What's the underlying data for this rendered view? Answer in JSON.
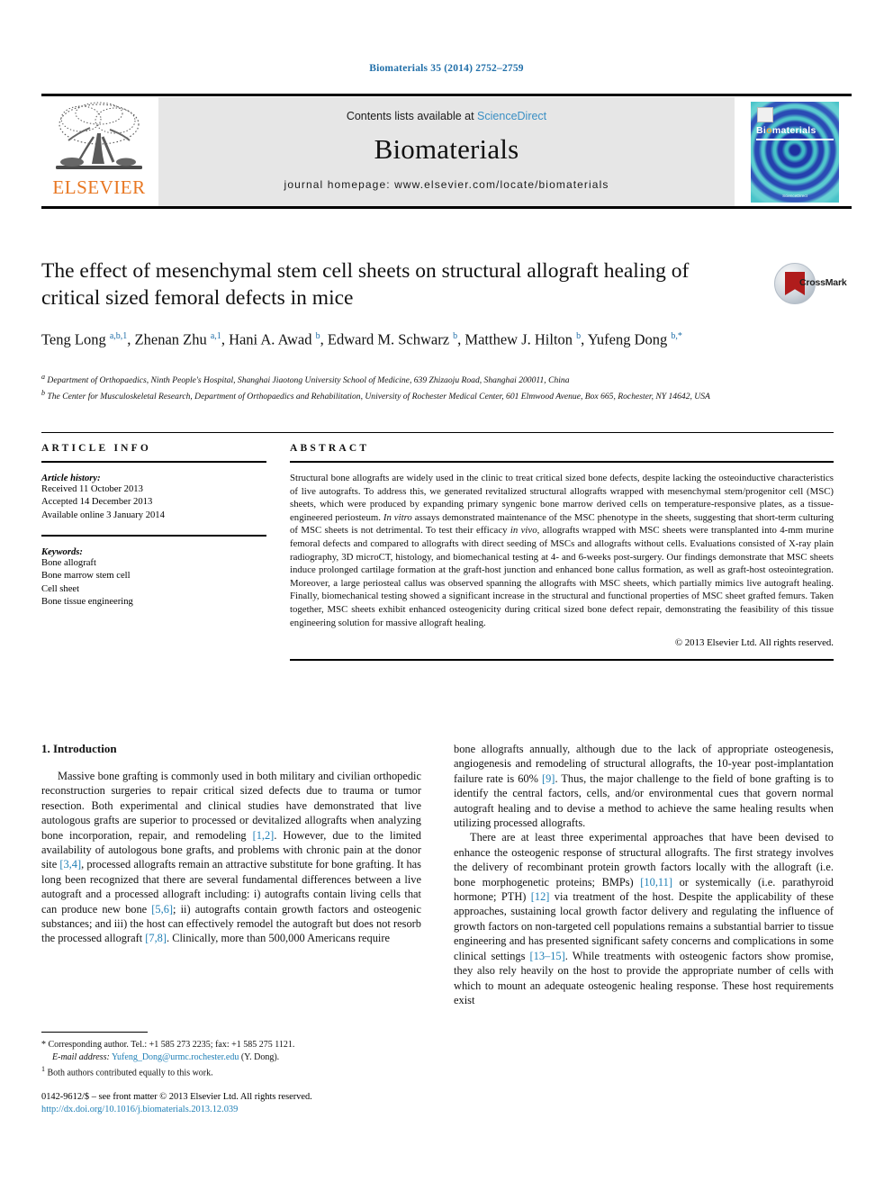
{
  "running_head": "Biomaterials 35 (2014) 2752–2759",
  "masthead": {
    "contents_prefix": "Contents lists available at ",
    "sciencedirect": "ScienceDirect",
    "journal_name": "Biomaterials",
    "homepage": "journal homepage: www.elsevier.com/locate/biomaterials",
    "publisher_wordmark": "ELSEVIER",
    "cover_title_first": "Bi",
    "cover_title_o": "o",
    "cover_title_rest": "materials",
    "cover_footer": "ScienceDirect"
  },
  "crossmark": {
    "label": "CrossMark"
  },
  "article": {
    "title": "The effect of mesenchymal stem cell sheets on structural allograft healing of critical sized femoral defects in mice",
    "authors_html": "Teng Long <sup>a,b,1</sup>, Zhenan Zhu <sup>a,1</sup>, Hani A. Awad <sup>b</sup>, Edward M. Schwarz <sup>b</sup>, Matthew J. Hilton <sup>b</sup>, Yufeng Dong <sup>b,*</sup>",
    "affiliation_a": "Department of Orthopaedics, Ninth People's Hospital, Shanghai Jiaotong University School of Medicine, 639 Zhizaoju Road, Shanghai 200011, China",
    "affiliation_b": "The Center for Musculoskeletal Research, Department of Orthopaedics and Rehabilitation, University of Rochester Medical Center, 601 Elmwood Avenue, Box 665, Rochester, NY 14642, USA"
  },
  "info": {
    "heading": "ARTICLE INFO",
    "history_label": "Article history:",
    "history": [
      "Received 11 October 2013",
      "Accepted 14 December 2013",
      "Available online 3 January 2014"
    ],
    "keywords_label": "Keywords:",
    "keywords": [
      "Bone allograft",
      "Bone marrow stem cell",
      "Cell sheet",
      "Bone tissue engineering"
    ]
  },
  "abstract": {
    "heading": "ABSTRACT",
    "text_html": "Structural bone allografts are widely used in the clinic to treat critical sized bone defects, despite lacking the osteoinductive characteristics of live autografts. To address this, we generated revitalized structural allografts wrapped with mesenchymal stem/progenitor cell (MSC) sheets, which were produced by expanding primary syngenic bone marrow derived cells on temperature-responsive plates, as a tissue-engineered periosteum. <i>In vitro</i> assays demonstrated maintenance of the MSC phenotype in the sheets, suggesting that short-term culturing of MSC sheets is not detrimental. To test their efficacy <i>in vivo</i>, allografts wrapped with MSC sheets were transplanted into 4-mm murine femoral defects and compared to allografts with direct seeding of MSCs and allografts without cells. Evaluations consisted of X-ray plain radiography, 3D microCT, histology, and biomechanical testing at 4- and 6-weeks post-surgery. Our findings demonstrate that MSC sheets induce prolonged cartilage formation at the graft-host junction and enhanced bone callus formation, as well as graft-host osteointegration. Moreover, a large periosteal callus was observed spanning the allografts with MSC sheets, which partially mimics live autograft healing. Finally, biomechanical testing showed a significant increase in the structural and functional properties of MSC sheet grafted femurs. Taken together, MSC sheets exhibit enhanced osteogenicity during critical sized bone defect repair, demonstrating the feasibility of this tissue engineering solution for massive allograft healing.",
    "copyright": "© 2013 Elsevier Ltd. All rights reserved."
  },
  "body": {
    "section_heading": "1. Introduction",
    "left_p1_html": "Massive bone grafting is commonly used in both military and civilian orthopedic reconstruction surgeries to repair critical sized defects due to trauma or tumor resection. Both experimental and clinical studies have demonstrated that live autologous grafts are superior to processed or devitalized allografts when analyzing bone incorporation, repair, and remodeling <span class=\"cite\">[1,2]</span>. However, due to the limited availability of autologous bone grafts, and problems with chronic pain at the donor site <span class=\"cite\">[3,4]</span>, processed allografts remain an attractive substitute for bone grafting. It has long been recognized that there are several fundamental differences between a live autograft and a processed allograft including: i) autografts contain living cells that can produce new bone <span class=\"cite\">[5,6]</span>; ii) autografts contain growth factors and osteogenic substances; and iii) the host can effectively remodel the autograft but does not resorb the processed allograft <span class=\"cite\">[7,8]</span>. Clinically, more than 500,000 Americans require",
    "right_p1_html": "bone allografts annually, although due to the lack of appropriate osteogenesis, angiogenesis and remodeling of structural allografts, the 10-year post-implantation failure rate is 60% <span class=\"cite\">[9]</span>. Thus, the major challenge to the field of bone grafting is to identify the central factors, cells, and/or environmental cues that govern normal autograft healing and to devise a method to achieve the same healing results when utilizing processed allografts.",
    "right_p2_html": "There are at least three experimental approaches that have been devised to enhance the osteogenic response of structural allografts. The first strategy involves the delivery of recombinant protein growth factors locally with the allograft (i.e. bone morphogenetic proteins; BMPs) <span class=\"cite\">[10,11]</span> or systemically (i.e. parathyroid hormone; PTH) <span class=\"cite\">[12]</span> via treatment of the host. Despite the applicability of these approaches, sustaining local growth factor delivery and regulating the influence of growth factors on non-targeted cell populations remains a substantial barrier to tissue engineering and has presented significant safety concerns and complications in some clinical settings <span class=\"cite\">[13–15]</span>. While treatments with osteogenic factors show promise, they also rely heavily on the host to provide the appropriate number of cells with which to mount an adequate osteogenic healing response. These host requirements exist"
  },
  "footnotes": {
    "corresponding_html": "* Corresponding author. Tel.: +1 585 273 2235; fax: +1 585 275 1121.",
    "email_label": "E-mail address:",
    "email": "Yufeng_Dong@urmc.rochester.edu",
    "email_suffix": "(Y. Dong).",
    "equal_contrib_html": "<sup>1</sup> Both authors contributed equally to this work."
  },
  "colophon": {
    "issn_line": "0142-9612/$ – see front matter © 2013 Elsevier Ltd. All rights reserved.",
    "doi": "http://dx.doi.org/10.1016/j.biomaterials.2013.12.039"
  },
  "colors": {
    "link_blue": "#1f7fb5",
    "header_blue": "#1f6ea8",
    "elsevier_orange": "#e87722",
    "panel_grey": "#e6e6e6"
  }
}
